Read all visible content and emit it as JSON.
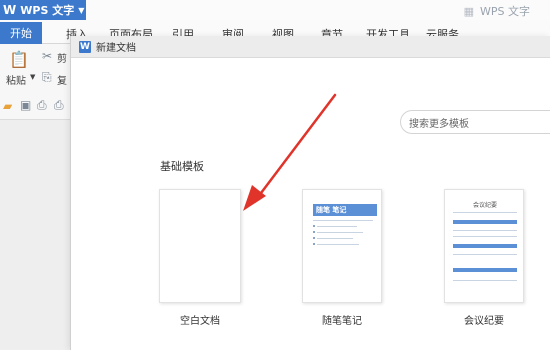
{
  "app": {
    "menu_button": "WPS 文字",
    "menu_logo": "W",
    "title_right": "WPS 文字",
    "accent_color": "#3c79cc"
  },
  "ribbon": {
    "tabs": [
      "开始",
      "插入",
      "页面布局",
      "引用",
      "审阅",
      "视图",
      "章节",
      "开发工具",
      "云服务"
    ],
    "paste_label": "粘贴",
    "cut_label": "剪",
    "copy_label": "复"
  },
  "dialog": {
    "title": "新建文档",
    "logo": "W",
    "search_placeholder": "搜索更多模板",
    "section_title": "基础模板",
    "templates": [
      {
        "label": "空白文档",
        "preview": "blank"
      },
      {
        "label": "随笔笔记",
        "preview": "notes",
        "header_text": "随笔 笔记"
      },
      {
        "label": "会议纪要",
        "preview": "meeting",
        "header_text": "会议纪要"
      }
    ]
  },
  "annotation": {
    "arrow_color": "#e0342b"
  }
}
